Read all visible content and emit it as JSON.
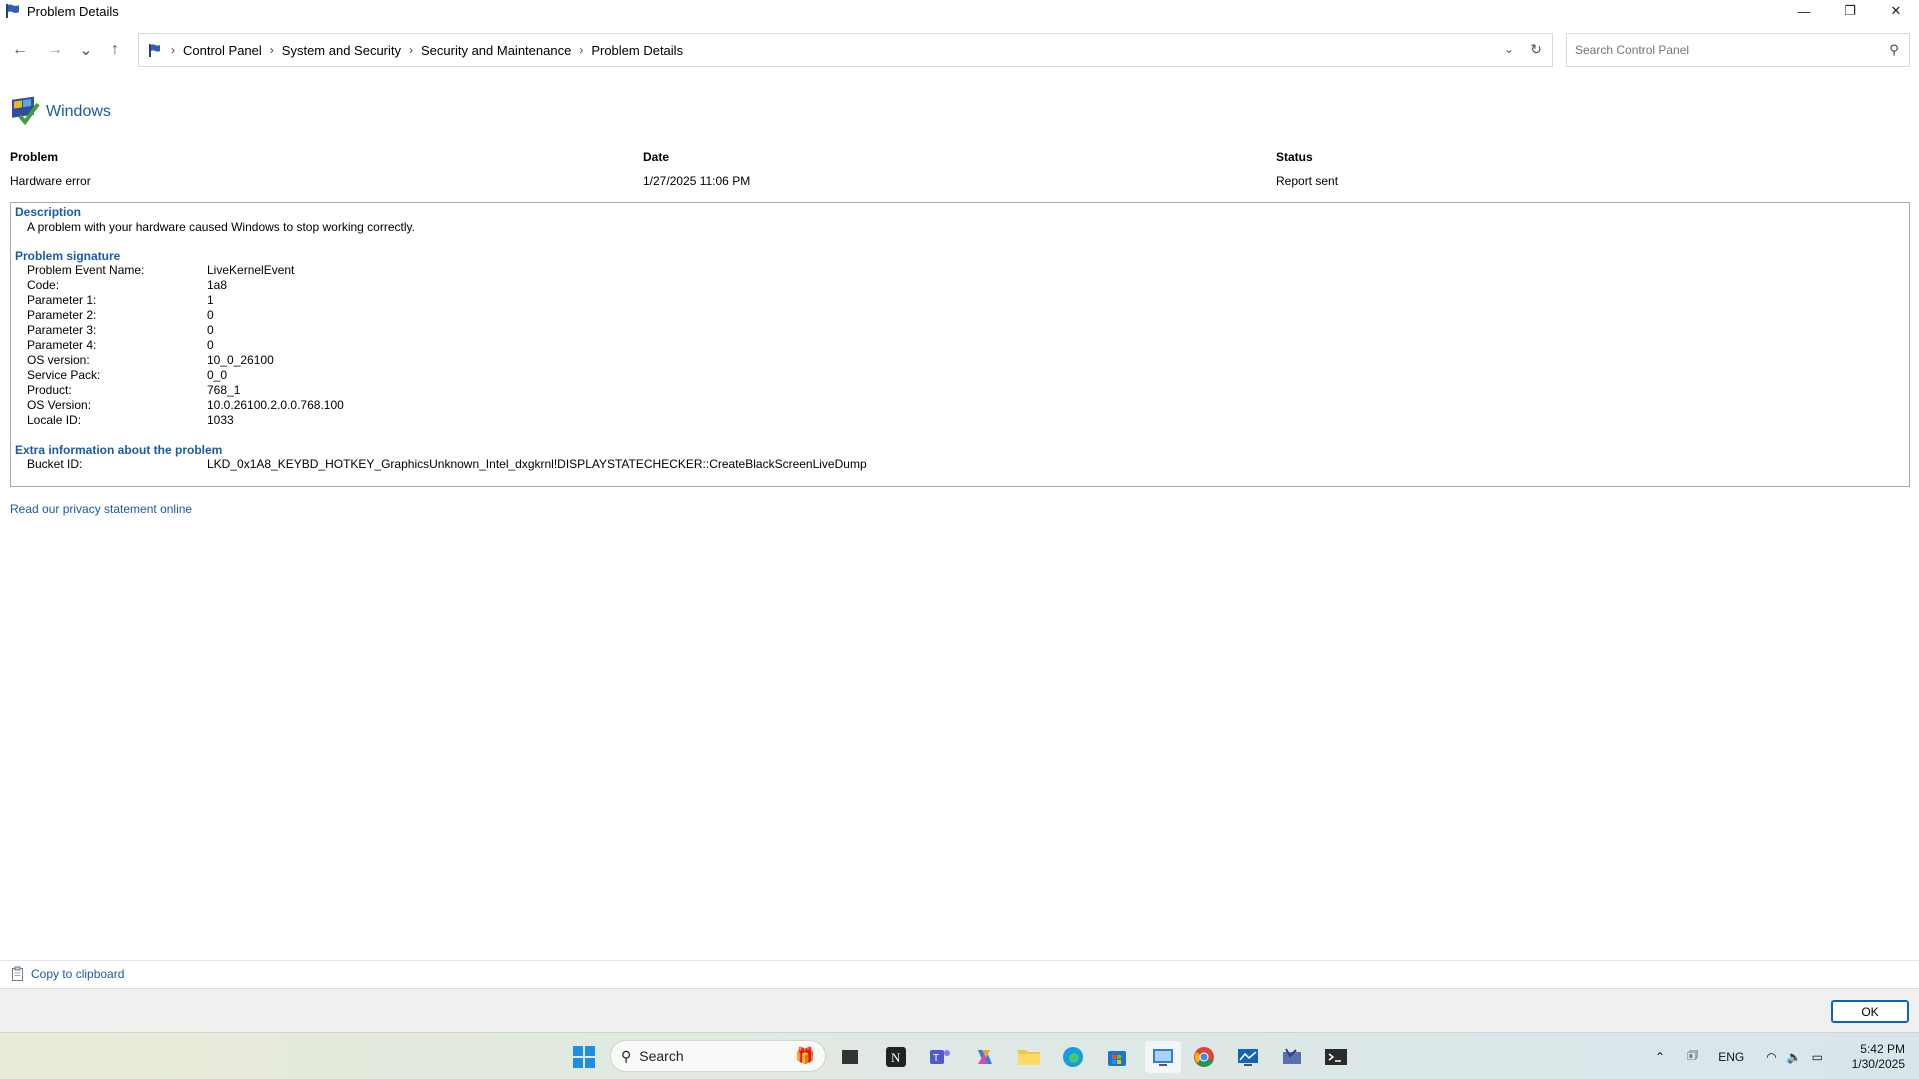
{
  "window": {
    "title": "Problem Details",
    "minimize": "—",
    "restore": "❐",
    "close": "✕"
  },
  "nav": {
    "back": "←",
    "forward": "→",
    "recent": "⌄",
    "up": "↑",
    "breadcrumbs": [
      "Control Panel",
      "System and Security",
      "Security and Maintenance",
      "Problem Details"
    ],
    "refresh": "↻",
    "dropdown": "⌄",
    "search_placeholder": "Search Control Panel"
  },
  "app": {
    "name": "Windows"
  },
  "summary": {
    "problem_header": "Problem",
    "problem_value": "Hardware error",
    "date_header": "Date",
    "date_value": "1/27/2025 11:06 PM",
    "status_header": "Status",
    "status_value": "Report sent"
  },
  "details": {
    "description_title": "Description",
    "description_text": "A problem with your hardware caused Windows to stop working correctly.",
    "signature_title": "Problem signature",
    "signature": [
      {
        "k": "Problem Event Name:",
        "v": "LiveKernelEvent"
      },
      {
        "k": "Code:",
        "v": "1a8"
      },
      {
        "k": "Parameter 1:",
        "v": "1"
      },
      {
        "k": "Parameter 2:",
        "v": "0"
      },
      {
        "k": "Parameter 3:",
        "v": "0"
      },
      {
        "k": "Parameter 4:",
        "v": "0"
      },
      {
        "k": "OS version:",
        "v": "10_0_26100"
      },
      {
        "k": "Service Pack:",
        "v": "0_0"
      },
      {
        "k": "Product:",
        "v": "768_1"
      },
      {
        "k": "OS Version:",
        "v": "10.0.26100.2.0.0.768.100"
      },
      {
        "k": "Locale ID:",
        "v": "1033"
      }
    ],
    "extra_title": "Extra information about the problem",
    "extra": [
      {
        "k": "Bucket ID:",
        "v": "LKD_0x1A8_KEYBD_HOTKEY_GraphicsUnknown_Intel_dxgkrnl!DISPLAYSTATECHECKER::CreateBlackScreenLiveDump"
      }
    ]
  },
  "links": {
    "privacy": "Read our privacy statement online",
    "copy": "Copy to clipboard"
  },
  "footer": {
    "ok": "OK"
  },
  "taskbar": {
    "search_label": "Search",
    "lang": "ENG",
    "time": "5:42 PM",
    "date": "1/30/2025"
  }
}
